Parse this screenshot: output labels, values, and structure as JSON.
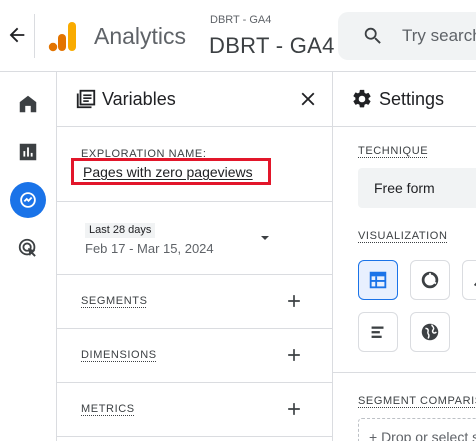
{
  "header": {
    "app_name": "Analytics",
    "property_sub": "DBRT - GA4",
    "property_name": "DBRT - GA4",
    "search_placeholder": "Try search"
  },
  "rail": {
    "items": [
      "home",
      "reports",
      "explore",
      "advertising"
    ],
    "active": "explore"
  },
  "variables": {
    "title": "Variables",
    "exploration_label": "EXPLORATION NAME:",
    "exploration_name": "Pages with zero pageviews",
    "date_chip": "Last 28 days",
    "date_range": "Feb 17 - Mar 15, 2024",
    "segments_label": "SEGMENTS",
    "dimensions_label": "DIMENSIONS",
    "metrics_label": "METRICS"
  },
  "settings": {
    "title": "Settings",
    "technique_label": "TECHNIQUE",
    "technique_value": "Free form",
    "visualization_label": "VISUALIZATION",
    "segment_comparisons_label": "SEGMENT COMPARISONS",
    "drop_text": "+ Drop or select segment"
  },
  "colors": {
    "accent": "#1a73e8",
    "highlight": "#e2162a",
    "logo_orange": "#f9ab00",
    "logo_dark_orange": "#e37400"
  }
}
